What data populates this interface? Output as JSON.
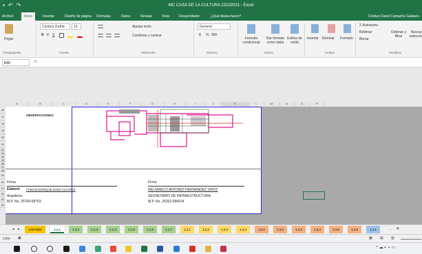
{
  "app": {
    "title": "MC CASA DE LA CULTURA 23102021 - Excel",
    "user": "Cristian David Camacho Galeano",
    "tell_me": "¿Qué desea hacer?"
  },
  "tabs": [
    "Archivo",
    "Inicio",
    "Insertar",
    "Diseño de página",
    "Fórmulas",
    "Datos",
    "Revisar",
    "Vista",
    "Desarrollador"
  ],
  "ribbon": {
    "clipboard": {
      "paste": "Pegar",
      "label": "Portapapeles"
    },
    "font": {
      "name": "Century Gothic",
      "size": "10",
      "bold": "N",
      "italic": "K",
      "underline": "S",
      "label": "Fuente"
    },
    "alignment": {
      "wrap": "Ajustar texto",
      "merge": "Combinar y centrar",
      "label": "Alineación"
    },
    "number": {
      "format": "General",
      "currency": "$",
      "percent": "%",
      "thousands": "000",
      "label": "Número"
    },
    "styles": {
      "conditional": "Formato condicional",
      "table": "Dar formato como tabla",
      "cell": "Estilos de celda",
      "label": "Estilos"
    },
    "cells": {
      "insert": "Insertar",
      "delete": "Eliminar",
      "format": "Formato",
      "label": "Celdas"
    },
    "editing": {
      "autosum": "Autosuma",
      "fill": "Rellenar",
      "clear": "Borrar",
      "sort": "Ordenar y filtrar",
      "find": "Buscar y seleccionar",
      "label": "Modificar"
    }
  },
  "formula_bar": {
    "name_box": "K60",
    "fx": "fx",
    "content": ""
  },
  "columns": [
    "A",
    "B",
    "C",
    "D",
    "E",
    "F",
    "G",
    "H",
    "I",
    "J",
    "K",
    "L",
    "M",
    "N",
    "O",
    "P"
  ],
  "rows": [
    "46",
    "47",
    "48",
    "49",
    "50",
    "51",
    "52",
    "53",
    "54",
    "55",
    "56",
    "57",
    "58",
    "59",
    "60",
    "61",
    "62",
    "63",
    "64"
  ],
  "sheet": {
    "observaciones": "OBSERVACIONES:",
    "firma_left": "Firma",
    "elaboro": "Elaboró",
    "elaboro_name": "FABIAN ENRIQUE BAEZ ALVAREZ",
    "role_left": "Arquitecto",
    "mp_left": "M.P. No. 25700-68753",
    "firma_right": "Firma",
    "name_right": "ING MARCO ANTONIO HERNANDEZ ORTIZ",
    "role_right": "SECRETARIO DE INFRAESTRUCTURA",
    "mp_right": "M.P. No. 25202-096614"
  },
  "sheet_tabs": [
    {
      "label": "LISTADO",
      "color": "#f5c400",
      "active": false
    },
    {
      "label": "1,1,1",
      "color": "#ffffff",
      "active": true
    },
    {
      "label": "1,1,2",
      "color": "#a9d18e",
      "active": false
    },
    {
      "label": "1,1,3",
      "color": "#a9d18e",
      "active": false
    },
    {
      "label": "1,1,4",
      "color": "#a9d18e",
      "active": false
    },
    {
      "label": "1,1,5",
      "color": "#a9d18e",
      "active": false
    },
    {
      "label": "1,1,6",
      "color": "#a9d18e",
      "active": false
    },
    {
      "label": "1,1,7",
      "color": "#a9d18e",
      "active": false
    },
    {
      "label": "1,2,1",
      "color": "#ffd966",
      "active": false
    },
    {
      "label": "1,2,2",
      "color": "#ffd966",
      "active": false
    },
    {
      "label": "1,2,3",
      "color": "#ffd966",
      "active": false
    },
    {
      "label": "1,2,4",
      "color": "#ffd966",
      "active": false
    },
    {
      "label": "1,3,1",
      "color": "#f4b183",
      "active": false
    },
    {
      "label": "1,3,2",
      "color": "#f4b183",
      "active": false
    },
    {
      "label": "1,3,3",
      "color": "#f4b183",
      "active": false
    },
    {
      "label": "1,3,4",
      "color": "#f4b183",
      "active": false
    },
    {
      "label": "1,3,5",
      "color": "#f4b183",
      "active": false
    },
    {
      "label": "1,3,6",
      "color": "#f4b183",
      "active": false
    },
    {
      "label": "1,4,1",
      "color": "#9dc3e6",
      "active": false
    }
  ],
  "sheet_more": "...",
  "status": {
    "mode": "Listo"
  },
  "colors": {
    "excel_green": "#217346",
    "page_border": "#2b2bd8",
    "plan_magenta": "#e0138c"
  }
}
